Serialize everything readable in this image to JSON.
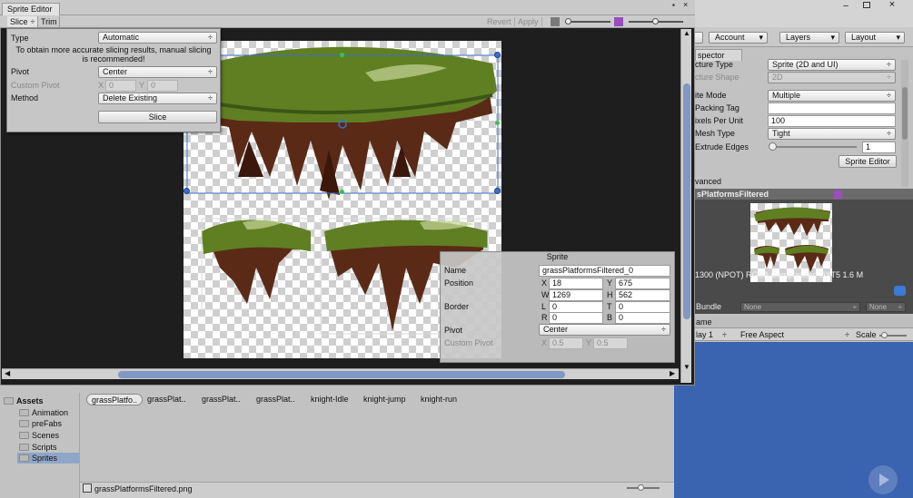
{
  "colors": {
    "editor_bg": "#1e1e1e",
    "selection": "#3b6fd0",
    "rect_handle": "#39c24b",
    "grass": "#5f7f22",
    "bark": "#5a2a17",
    "preview_blue": "#3a63b0"
  },
  "top_toolbar": {
    "account": "Account",
    "layers": "Layers",
    "layout": "Layout"
  },
  "sprite_editor": {
    "title": "Sprite Editor",
    "slice_menu": "Slice",
    "trim": "Trim",
    "revert": "Revert",
    "apply": "Apply"
  },
  "slice_popup": {
    "type_label": "Type",
    "type_value": "Automatic",
    "warning": "To obtain more accurate slicing results, manual slicing is recommended!",
    "pivot_label": "Pivot",
    "pivot_value": "Center",
    "custom_pivot_label": "Custom Pivot",
    "cp_x_label": "X",
    "cp_x": "0",
    "cp_y_label": "Y",
    "cp_y": "0",
    "method_label": "Method",
    "method_value": "Delete Existing",
    "slice_button": "Slice"
  },
  "sprite_panel": {
    "title": "Sprite",
    "name_label": "Name",
    "name_value": "grassPlatformsFiltered_0",
    "position_label": "Position",
    "x_label": "X",
    "x": "18",
    "y_label": "Y",
    "y": "675",
    "w_label": "W",
    "w": "1269",
    "h_label": "H",
    "h": "562",
    "border_label": "Border",
    "l_label": "L",
    "l": "0",
    "t_label": "T",
    "t": "0",
    "r_label": "R",
    "r": "0",
    "b_label": "B",
    "b": "0",
    "pivot_label": "Pivot",
    "pivot_value": "Center",
    "custom_pivot_label": "Custom Pivot",
    "cp_x_label": "X",
    "cp_x": "0.5",
    "cp_y_label": "Y",
    "cp_y": "0.5"
  },
  "inspector": {
    "tab": "spector",
    "texture_type_label": "cture Type",
    "texture_type_value": "Sprite (2D and UI)",
    "texture_shape_label": "cture Shape",
    "texture_shape_value": "2D",
    "sprite_mode_label": "ite Mode",
    "sprite_mode_value": "Multiple",
    "packing_tag_label": "Packing Tag",
    "packing_tag_value": "",
    "ppu_label": "ixels Per Unit",
    "ppu_value": "100",
    "mesh_type_label": "Mesh Type",
    "mesh_type_value": "Tight",
    "extrude_label": "Extrude Edges",
    "extrude_value": "1",
    "sprite_editor_button": "Sprite Editor",
    "advanced_label": "vanced",
    "preview_title": "sPlatformsFiltered",
    "info_line": "1300 (NPOT)  RGBA Compressed DXT5   1.6 M",
    "assetbundle_label": "Bundle",
    "assetbundle_value": "None",
    "assetbundle_variant": "None"
  },
  "game_panel": {
    "tab": "ame",
    "display": "lay 1",
    "aspect": "Free Aspect",
    "scale_label": "Scale"
  },
  "project": {
    "tree": [
      {
        "label": "Assets"
      },
      {
        "label": "Animation"
      },
      {
        "label": "preFabs"
      },
      {
        "label": "Scenes"
      },
      {
        "label": "Scripts"
      },
      {
        "label": "Sprites"
      }
    ],
    "assets": [
      "grassPlatfo..",
      "grassPlat..",
      "grassPlat..",
      "grassPlat..",
      "knight-Idle",
      "knight-jump",
      "knight-run"
    ],
    "footer_file": "grassPlatformsFiltered.png"
  }
}
